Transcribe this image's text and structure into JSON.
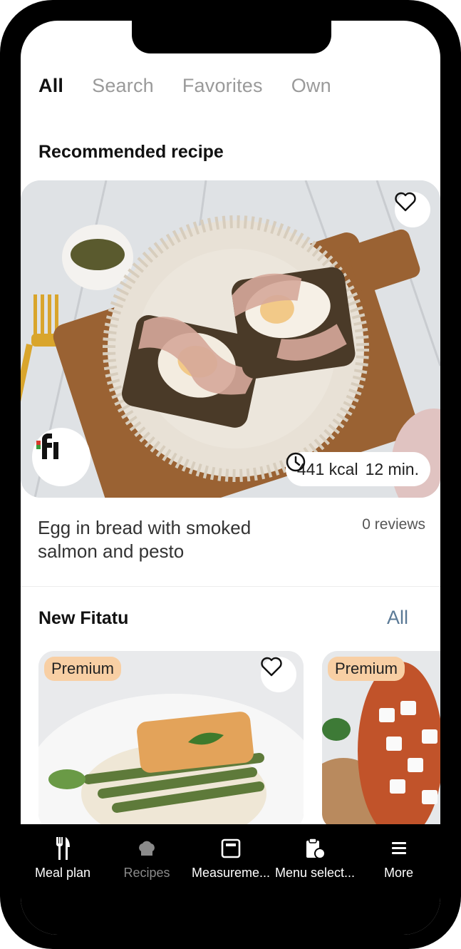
{
  "tabs": [
    "All",
    "Search",
    "Favorites",
    "Own"
  ],
  "recommended": {
    "section_title": "Recommended recipe",
    "recipe_name": "Egg in bread with smoked salmon and pesto",
    "reviews": "0 reviews",
    "kcal": "441 kcal",
    "time": "12 min.",
    "brand_logo_text": "fi"
  },
  "new_section": {
    "title": "New Fitatu",
    "all_link": "All",
    "cards": [
      {
        "badge": "Premium"
      },
      {
        "badge": "Premium"
      }
    ]
  },
  "nav": [
    {
      "label": "Meal plan",
      "icon": "fork-knife-icon",
      "active": true
    },
    {
      "label": "Recipes",
      "icon": "chef-hat-icon",
      "active": false
    },
    {
      "label": "Measureme...",
      "icon": "scale-icon",
      "active": true
    },
    {
      "label": "Menu select...",
      "icon": "clipboard-apple-icon",
      "active": true
    },
    {
      "label": "More",
      "icon": "menu-icon",
      "active": true
    }
  ],
  "colors": {
    "accent_link": "#5b7a96",
    "premium_badge": "#f8cfa4"
  }
}
